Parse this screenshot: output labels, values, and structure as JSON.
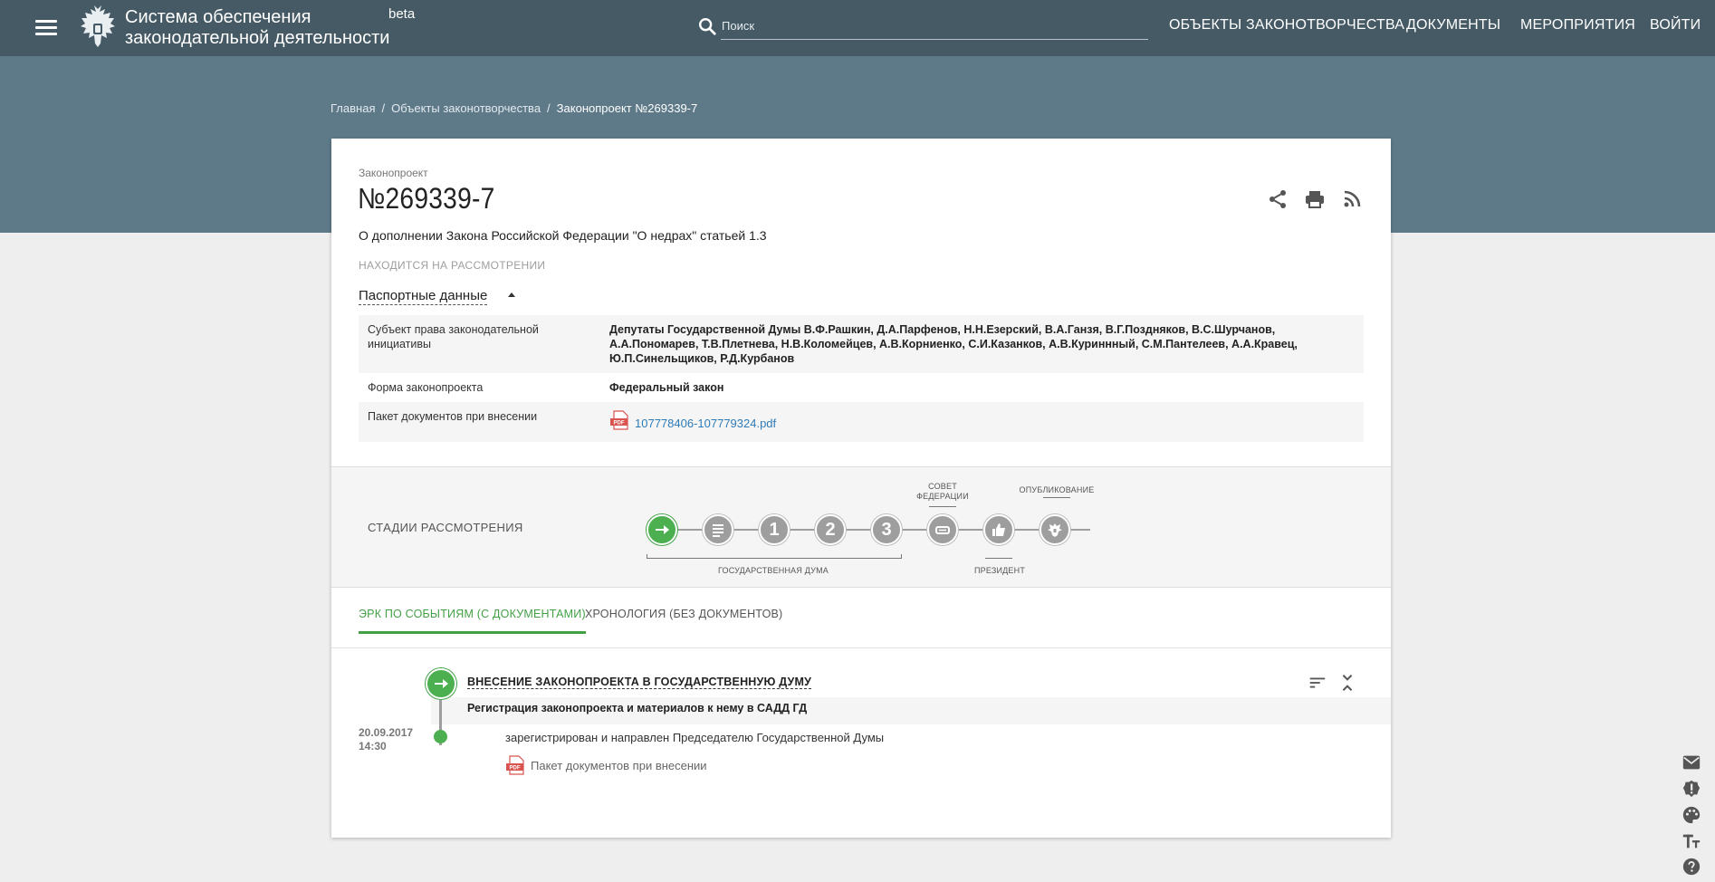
{
  "header": {
    "title_line1": "Система обеспечения",
    "title_line2": "законодательной деятельности",
    "beta": "beta",
    "search_placeholder": "Поиск",
    "nav": [
      "ОБЪЕКТЫ ЗАКОНОТВОРЧЕСТВА",
      "ДОКУМЕНТЫ",
      "МЕРОПРИЯТИЯ",
      "ВОЙТИ"
    ]
  },
  "breadcrumb": {
    "home": "Главная",
    "section": "Объекты законотворчества",
    "current": "Законопроект №269339-7",
    "separator": "/"
  },
  "bill": {
    "type_label": "Законопроект",
    "number": "№269339-7",
    "title": "О дополнении Закона Российской Федерации \"О недрах\" статьей 1.3",
    "status": "НАХОДИТСЯ НА РАССМОТРЕНИИ",
    "actions": [
      "share-icon",
      "print-icon",
      "rss-icon"
    ]
  },
  "passport": {
    "toggle_label": "Паспортные данные",
    "rows": [
      {
        "key": "Субъект права законодательной инициативы",
        "value": "Депутаты Государственной Думы В.Ф.Рашкин, Д.А.Парфенов, Н.Н.Езерский, В.А.Ганзя, В.Г.Поздняков, В.С.Шурчанов, А.А.Пономарев, Т.В.Плетнева, Н.В.Коломейцев, А.В.Корниенко, С.И.Казанков, А.В.Куриннный, С.М.Пантелеев, А.А.Кравец, Ю.П.Синельщиков, Р.Д.Курбанов"
      },
      {
        "key": "Форма законопроекта",
        "value": "Федеральный закон"
      },
      {
        "key": "Пакет документов при внесении",
        "value": "107778406-107779324.pdf",
        "icon": "pdf-icon"
      }
    ]
  },
  "stages": {
    "label": "СТАДИИ РАССМОТРЕНИЯ",
    "steps": [
      {
        "icon": "arrow-right-icon",
        "text": "",
        "active": true
      },
      {
        "icon": "document-list-icon",
        "text": ""
      },
      {
        "icon": "",
        "text": "1"
      },
      {
        "icon": "",
        "text": "2"
      },
      {
        "icon": "",
        "text": "3"
      },
      {
        "icon": "council-icon",
        "text": ""
      },
      {
        "icon": "thumbs-up-icon",
        "text": ""
      },
      {
        "icon": "eagle-emblem-icon",
        "text": ""
      }
    ],
    "caption_duma": "ГОСУДАРСТВЕННАЯ ДУМА",
    "caption_council": "СОВЕТ ФЕДЕРАЦИИ",
    "caption_president": "ПРЕЗИДЕНТ",
    "caption_publish": "ОПУБЛИКОВАНИЕ"
  },
  "tabs": {
    "active": "ЭРК ПО СОБЫТИЯМ (С ДОКУМЕНТАМИ)",
    "inactive": "ХРОНОЛОГИЯ (БЕЗ ДОКУМЕНТОВ)"
  },
  "event": {
    "title": "ВНЕСЕНИЕ ЗАКОНОПРОЕКТА В ГОСУДАРСТВЕННУЮ ДУМУ",
    "subtitle": "Регистрация законопроекта и материалов к нему в САДД ГД",
    "date": "20.09.2017",
    "time": "14:30",
    "description": "зарегистрирован и направлен Председателю Государственной Думы",
    "doc_label": "Пакет документов при внесении"
  },
  "sidebar_icons": [
    "mail-icon",
    "feedback-icon",
    "palette-icon",
    "text-size-icon",
    "help-icon"
  ],
  "colors": {
    "header": "#455a64",
    "hero": "#5e7a89",
    "accent": "#4caf50",
    "link": "#2f7bb6"
  }
}
